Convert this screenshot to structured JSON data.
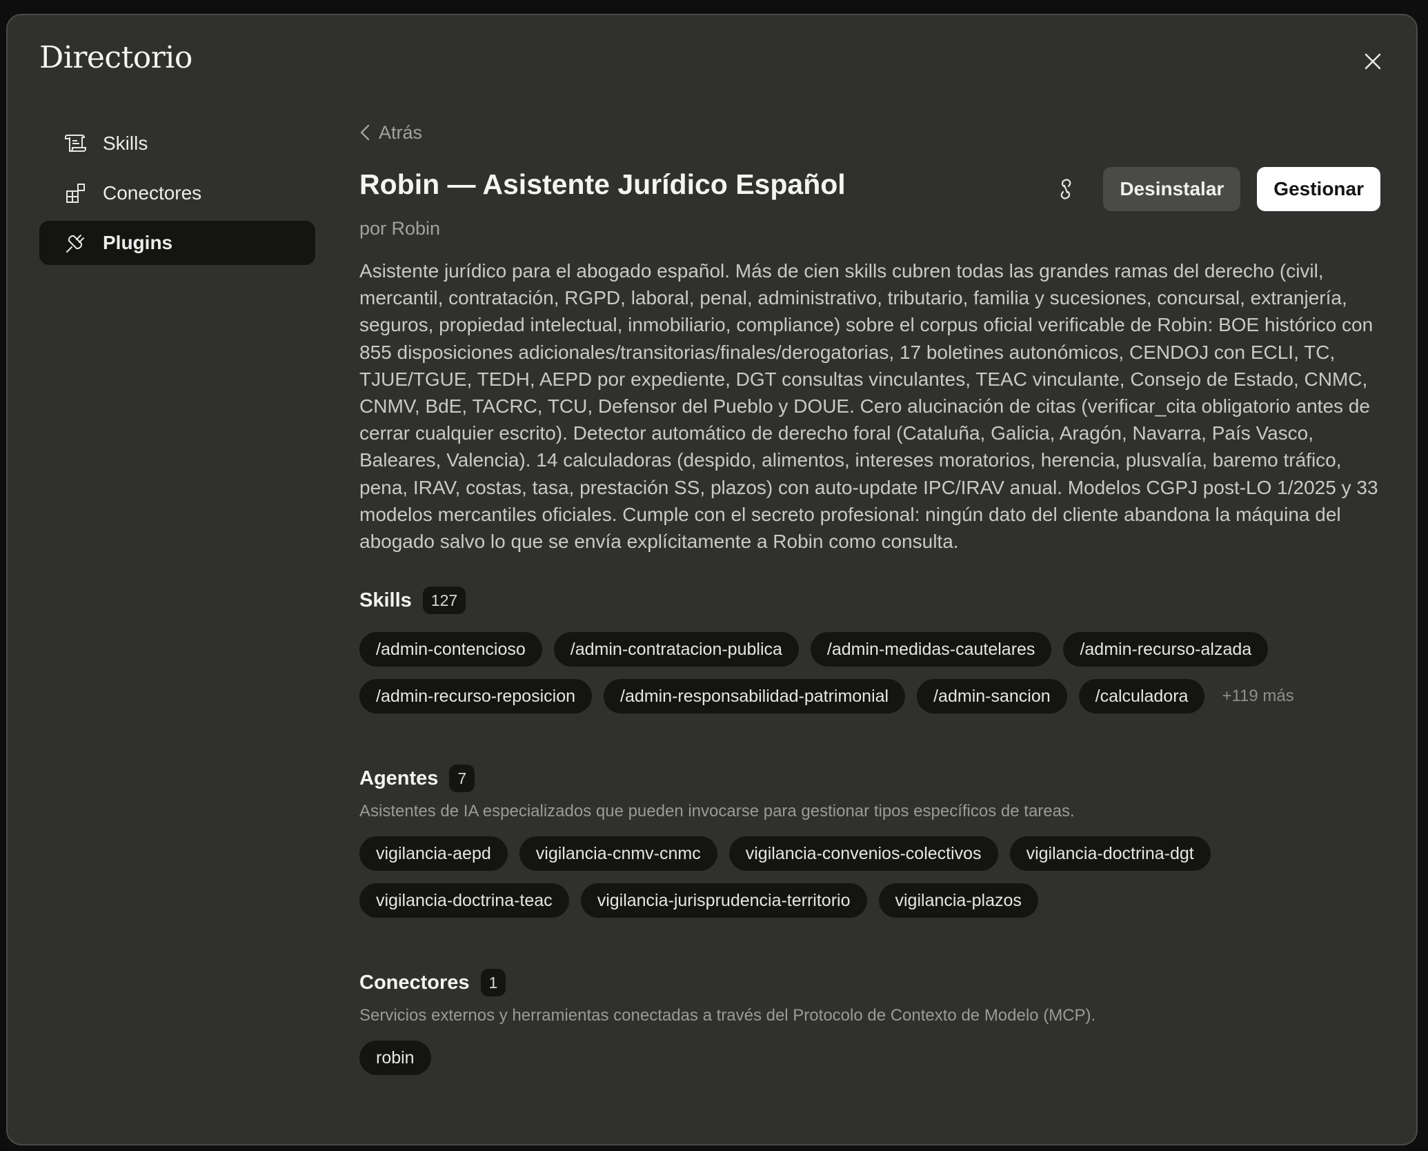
{
  "modal": {
    "title": "Directorio",
    "close_icon": "close-icon"
  },
  "sidebar": {
    "items": [
      {
        "label": "Skills",
        "icon": "scroll-icon",
        "active": false
      },
      {
        "label": "Conectores",
        "icon": "blocks-icon",
        "active": false
      },
      {
        "label": "Plugins",
        "icon": "plug-icon",
        "active": true
      }
    ]
  },
  "main": {
    "back_label": "Atrás",
    "plugin_title": "Robin — Asistente Jurídico Español",
    "author": "por Robin",
    "actions": {
      "link_icon": "link-icon",
      "uninstall_label": "Desinstalar",
      "manage_label": "Gestionar"
    },
    "description": "Asistente jurídico para el abogado español. Más de cien skills cubren todas las grandes ramas del derecho (civil, mercantil, contratación, RGPD, laboral, penal, administrativo, tributario, familia y sucesiones, concursal, extranjería, seguros, propiedad intelectual, inmobiliario, compliance) sobre el corpus oficial verificable de Robin: BOE histórico con 855 disposiciones adicionales/transitorias/finales/derogatorias, 17 boletines autonómicos, CENDOJ con ECLI, TC, TJUE/TGUE, TEDH, AEPD por expediente, DGT consultas vinculantes, TEAC vinculante, Consejo de Estado, CNMC, CNMV, BdE, TACRC, TCU, Defensor del Pueblo y DOUE. Cero alucinación de citas (verificar_cita obligatorio antes de cerrar cualquier escrito). Detector automático de derecho foral (Cataluña, Galicia, Aragón, Navarra, País Vasco, Baleares, Valencia). 14 calculadoras (despido, alimentos, intereses moratorios, herencia, plusvalía, baremo tráfico, pena, IRAV, costas, tasa, prestación SS, plazos) con auto-update IPC/IRAV anual. Modelos CGPJ post-LO 1/2025 y 33 modelos mercantiles oficiales. Cumple con el secreto profesional: ningún dato del cliente abandona la máquina del abogado salvo lo que se envía explícitamente a Robin como consulta."
  },
  "skills": {
    "title": "Skills",
    "count": "127",
    "items": [
      "/admin-contencioso",
      "/admin-contratacion-publica",
      "/admin-medidas-cautelares",
      "/admin-recurso-alzada",
      "/admin-recurso-reposicion",
      "/admin-responsabilidad-patrimonial",
      "/admin-sancion",
      "/calculadora"
    ],
    "more": "+119 más"
  },
  "agents": {
    "title": "Agentes",
    "count": "7",
    "description": "Asistentes de IA especializados que pueden invocarse para gestionar tipos específicos de tareas.",
    "items": [
      "vigilancia-aepd",
      "vigilancia-cnmv-cnmc",
      "vigilancia-convenios-colectivos",
      "vigilancia-doctrina-dgt",
      "vigilancia-doctrina-teac",
      "vigilancia-jurisprudencia-territorio",
      "vigilancia-plazos"
    ]
  },
  "connectors": {
    "title": "Conectores",
    "count": "1",
    "description": "Servicios externos y herramientas conectadas a través del Protocolo de Contexto de Modelo (MCP).",
    "items": [
      "robin"
    ]
  },
  "colors": {
    "background": "#30302e",
    "chip": "#141413",
    "primary_button": "#ffffff",
    "secondary_button": "#4a4a47"
  }
}
